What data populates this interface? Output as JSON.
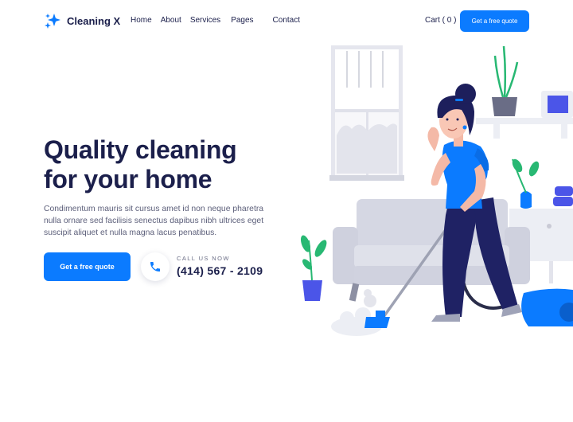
{
  "brand": {
    "name": "Cleaning X",
    "accent": "#0b7bff",
    "text": "#1b1f4b"
  },
  "nav": {
    "links": [
      "Home",
      "About",
      "Services",
      "Pages",
      "Contact"
    ],
    "cart": "Cart ( 0 )",
    "cta": "Get a free quote"
  },
  "hero": {
    "headline_line1": "Quality cleaning",
    "headline_line2": "for your home",
    "paragraph": "Condimentum mauris sit cursus amet id non neque pharetra nulla ornare sed facilisis senectus dapibus nibh ultrices eget suscipit aliquet et nulla magna lacus penatibus.",
    "cta": "Get a free quote",
    "call_label": "CALL US NOW",
    "phone": "(414) 567 - 2109"
  },
  "icons": {
    "logo": "sparkle-icon",
    "phone": "phone-icon"
  }
}
